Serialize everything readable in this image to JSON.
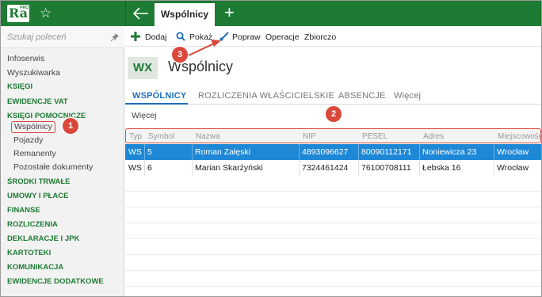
{
  "topbar": {
    "logo_text": "Ra",
    "logo_sup": "PRO",
    "active_tab": "Wspólnicy",
    "accent": "#1e7b34"
  },
  "sidebar": {
    "search_placeholder": "Szukaj poleceń",
    "items": [
      {
        "label": "Infoserwis",
        "type": "plain"
      },
      {
        "label": "Wyszukiwarka",
        "type": "plain"
      },
      {
        "label": "KSIĘGI",
        "type": "section"
      },
      {
        "label": "EWIDENCJE VAT",
        "type": "section"
      },
      {
        "label": "KSIĘGI POMOCNICZE",
        "type": "section"
      },
      {
        "label": "Wspólnicy",
        "type": "sub",
        "selected": true
      },
      {
        "label": "Pojazdy",
        "type": "sub"
      },
      {
        "label": "Remanenty",
        "type": "sub"
      },
      {
        "label": "Pozostałe dokumenty",
        "type": "sub"
      },
      {
        "label": "ŚRODKI TRWAŁE",
        "type": "section"
      },
      {
        "label": "UMOWY I PŁACE",
        "type": "section"
      },
      {
        "label": "FINANSE",
        "type": "section"
      },
      {
        "label": "ROZLICZENIA",
        "type": "section"
      },
      {
        "label": "DEKLARACJE I JPK",
        "type": "section"
      },
      {
        "label": "KARTOTEKI",
        "type": "section"
      },
      {
        "label": "KOMUNIKACJA",
        "type": "section"
      },
      {
        "label": "EWIDENCJE DODATKOWE",
        "type": "section"
      }
    ]
  },
  "toolbar": {
    "add_label": "Dodaj",
    "show_label": "Pokaż",
    "edit_label": "Popraw",
    "operations_label": "Operacje",
    "bulk_label": "Zbiorczo"
  },
  "header": {
    "code": "WX",
    "title": "Wspólnicy"
  },
  "tabs": [
    {
      "label": "WSPÓLNICY",
      "active": true
    },
    {
      "label": "ROZLICZENIA WŁAŚCICIELSKIE",
      "active": false
    },
    {
      "label": "ABSENCJE",
      "active": false
    },
    {
      "label": "Więcej",
      "active": false
    }
  ],
  "subtab": "Więcej",
  "table": {
    "columns": [
      "Typ",
      "Symbol",
      "Nazwa",
      "NIP",
      "PESEL",
      "Adres",
      "Miejscowość"
    ],
    "rows": [
      [
        "WS",
        "5",
        "Roman Załęski",
        "4893096627",
        "80090112171",
        "Noniewicza 23",
        "Wrocław"
      ],
      [
        "WS",
        "6",
        "Marian Skarżyński",
        "7324461424",
        "76100708111",
        "Łebska 16",
        "Wrocław"
      ]
    ]
  },
  "callouts": {
    "one": "1",
    "two": "2",
    "three": "3"
  },
  "colors": {
    "callout": "#d9483b",
    "selection": "#1e88d7",
    "tab_active": "#1e6fb8"
  }
}
